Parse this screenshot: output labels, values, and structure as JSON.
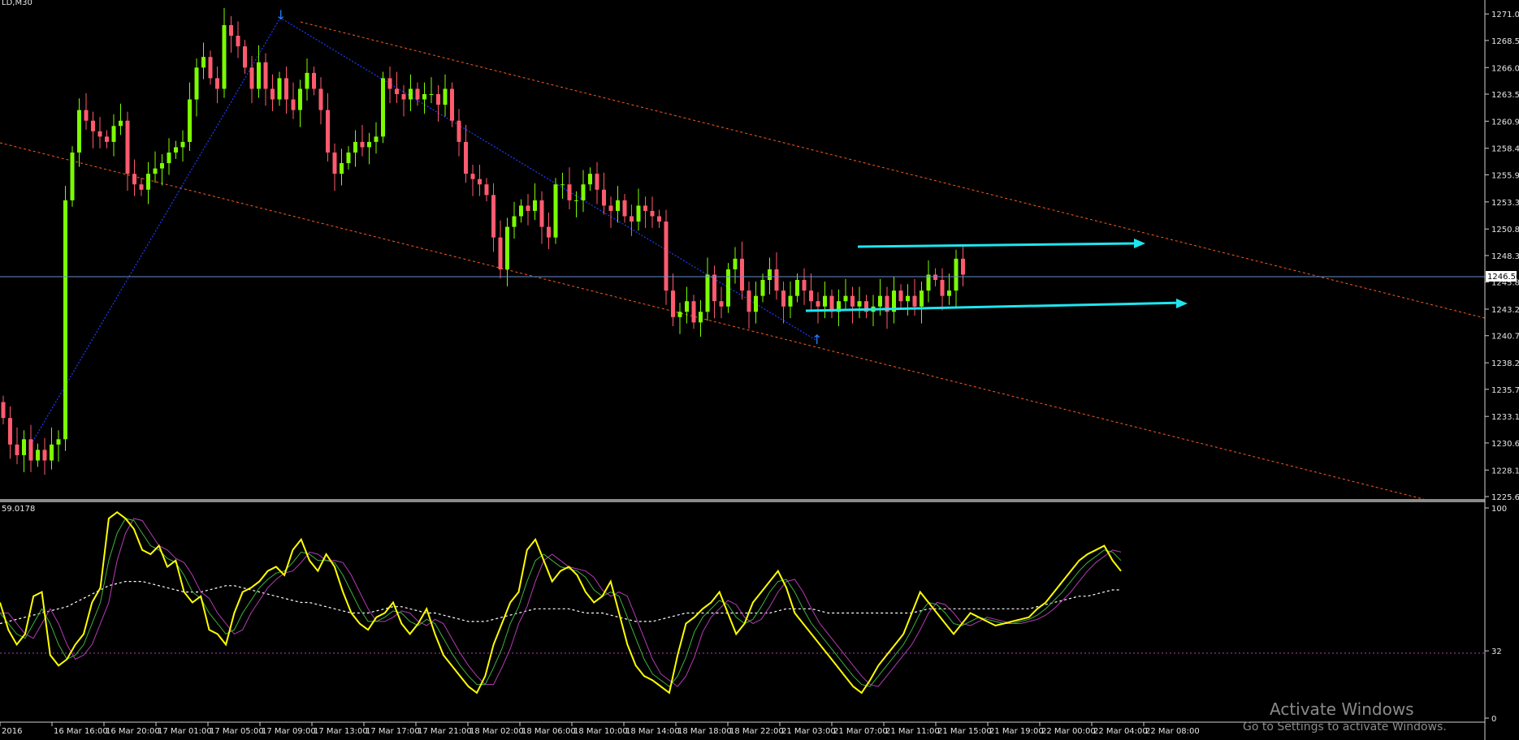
{
  "symbol_label": "LD,M30",
  "indicator_value": "59.0178",
  "price_axis": {
    "ticks": [
      "1271.05",
      "1268.55",
      "1266.00",
      "1263.50",
      "1260.95",
      "1258.40",
      "1255.90",
      "1253.35",
      "1250.80",
      "1248.30",
      "1245.80",
      "1243.25",
      "1240.75",
      "1238.20",
      "1235.70",
      "1233.15",
      "1230.65",
      "1228.10",
      "1225.60"
    ],
    "current_price": "1246.50"
  },
  "indicator_axis": {
    "ticks": [
      "100",
      "32",
      "0"
    ],
    "level": 32
  },
  "time_axis": [
    "2016",
    "16 Mar 16:00",
    "16 Mar 20:00",
    "17 Mar 01:00",
    "17 Mar 05:00",
    "17 Mar 09:00",
    "17 Mar 13:00",
    "17 Mar 17:00",
    "17 Mar 21:00",
    "18 Mar 02:00",
    "18 Mar 06:00",
    "18 Mar 10:00",
    "18 Mar 14:00",
    "18 Mar 18:00",
    "18 Mar 22:00",
    "21 Mar 03:00",
    "21 Mar 07:00",
    "21 Mar 11:00",
    "21 Mar 15:00",
    "21 Mar 19:00",
    "22 Mar 00:00",
    "22 Mar 04:00",
    "22 Mar 08:00"
  ],
  "watermark": {
    "title": "Activate Windows",
    "subtitle": "Go to Settings to activate Windows."
  },
  "colors": {
    "background": "#000000",
    "bull": "#7cfc00",
    "bear": "#ff5a6e",
    "channel": "#ff5a1a",
    "zigzag": "#1e3cff",
    "cyan": "#1ee6f0",
    "price_line": "#6a8cc8",
    "stoch_main": "#ffff00",
    "stoch_signal": "#3cb43c",
    "stoch_signal2": "#b43cb4",
    "stoch_ma": "#ffffff",
    "level_line": "#b43cb4"
  },
  "chart_data": {
    "type": "candlestick",
    "ylim": [
      1225.6,
      1271.6
    ],
    "candle_closes": [
      1233.0,
      1230.5,
      1229.5,
      1231.0,
      1229.0,
      1230.0,
      1229.0,
      1230.5,
      1231.0,
      1253.5,
      1258.0,
      1262.0,
      1261.0,
      1260.0,
      1259.5,
      1259.0,
      1260.5,
      1261.0,
      1256.0,
      1255.0,
      1254.5,
      1256.0,
      1256.5,
      1257.0,
      1258.0,
      1258.5,
      1259.0,
      1263.0,
      1266.0,
      1267.0,
      1265.0,
      1264.0,
      1270.0,
      1269.0,
      1268.0,
      1266.0,
      1264.0,
      1266.5,
      1264.0,
      1263.0,
      1265.0,
      1263.0,
      1262.0,
      1264.0,
      1265.5,
      1264.0,
      1262.0,
      1258.0,
      1256.0,
      1257.0,
      1258.0,
      1259.0,
      1258.5,
      1259.0,
      1259.5,
      1265.0,
      1264.0,
      1263.5,
      1263.0,
      1264.0,
      1263.0,
      1263.5,
      1263.5,
      1262.5,
      1264.0,
      1261.0,
      1259.0,
      1256.0,
      1255.5,
      1255.0,
      1254.0,
      1250.0,
      1247.0,
      1251.0,
      1252.0,
      1253.0,
      1252.5,
      1253.5,
      1251.0,
      1250.0,
      1255.0,
      1255.0,
      1253.5,
      1253.5,
      1255.0,
      1256.0,
      1254.5,
      1253.0,
      1252.5,
      1253.5,
      1252.0,
      1251.5,
      1253.0,
      1252.5,
      1252.0,
      1251.5,
      1245.0,
      1242.5,
      1243.0,
      1244.0,
      1242.0,
      1243.0,
      1246.5,
      1244.0,
      1243.5,
      1247.0,
      1248.0,
      1245.0,
      1243.0,
      1244.5,
      1246.0,
      1247.0,
      1245.0,
      1243.5,
      1244.5,
      1246.0,
      1245.0,
      1244.0,
      1243.5,
      1244.5,
      1243.0,
      1244.0,
      1244.5,
      1243.5,
      1244.0,
      1243.0,
      1243.5,
      1244.5,
      1243.0,
      1245.0,
      1244.0,
      1244.5,
      1243.5,
      1245.0,
      1246.5,
      1246.0,
      1244.5,
      1245.0,
      1248.0,
      1246.5
    ],
    "stochastic_k": [
      55,
      42,
      35,
      40,
      58,
      60,
      30,
      25,
      28,
      35,
      40,
      55,
      62,
      95,
      98,
      95,
      90,
      80,
      78,
      82,
      72,
      75,
      60,
      55,
      58,
      42,
      40,
      35,
      50,
      60,
      62,
      65,
      70,
      72,
      68,
      80,
      85,
      75,
      70,
      78,
      72,
      60,
      50,
      45,
      42,
      48,
      50,
      55,
      45,
      40,
      45,
      52,
      40,
      30,
      25,
      20,
      15,
      12,
      20,
      35,
      45,
      55,
      60,
      80,
      85,
      75,
      65,
      70,
      72,
      68,
      60,
      55,
      58,
      65,
      50,
      35,
      25,
      20,
      18,
      15,
      12,
      30,
      45,
      48,
      52,
      55,
      60,
      50,
      40,
      45,
      55,
      60,
      65,
      70,
      62,
      50,
      45,
      40,
      35,
      30,
      25,
      20,
      15,
      12,
      18,
      25,
      30,
      35,
      40,
      50,
      60,
      55,
      50,
      45,
      40,
      45,
      50,
      48,
      46,
      44,
      45,
      46,
      47,
      48,
      52,
      55,
      60,
      65,
      70,
      75,
      78,
      80,
      82,
      75,
      70
    ],
    "stochastic_d": [
      50,
      45,
      40,
      38,
      45,
      52,
      45,
      35,
      28,
      30,
      35,
      45,
      55,
      75,
      88,
      95,
      94,
      88,
      82,
      80,
      76,
      74,
      68,
      60,
      57,
      50,
      45,
      40,
      42,
      50,
      56,
      62,
      66,
      69,
      70,
      74,
      79,
      78,
      75,
      75,
      74,
      68,
      60,
      52,
      46,
      46,
      48,
      51,
      50,
      46,
      44,
      47,
      45,
      38,
      31,
      25,
      20,
      16,
      16,
      24,
      33,
      45,
      53,
      65,
      75,
      78,
      75,
      72,
      71,
      70,
      67,
      61,
      58,
      60,
      58,
      48,
      38,
      28,
      21,
      18,
      15,
      20,
      29,
      41,
      48,
      52,
      56,
      54,
      48,
      45,
      47,
      53,
      60,
      65,
      66,
      60,
      52,
      45,
      40,
      35,
      30,
      25,
      20,
      16,
      15,
      20,
      25,
      30,
      35,
      42,
      50,
      55,
      54,
      50,
      45,
      44,
      46,
      48,
      47,
      46,
      45,
      45,
      46,
      47,
      49,
      52,
      56,
      60,
      65,
      70,
      74,
      77,
      80,
      79,
      75
    ],
    "stochastic_ma": [
      45,
      46,
      47,
      48,
      49,
      50,
      51,
      52,
      53,
      55,
      57,
      59,
      61,
      63,
      64,
      65,
      65,
      65,
      64,
      63,
      62,
      61,
      60,
      60,
      60,
      61,
      62,
      63,
      63,
      62,
      61,
      60,
      59,
      58,
      57,
      56,
      55,
      55,
      54,
      53,
      52,
      51,
      50,
      50,
      50,
      51,
      52,
      53,
      53,
      52,
      51,
      50,
      50,
      49,
      48,
      47,
      46,
      46,
      46,
      47,
      48,
      49,
      50,
      51,
      52,
      52,
      52,
      52,
      52,
      51,
      50,
      50,
      50,
      49,
      48,
      47,
      46,
      46,
      46,
      47,
      48,
      49,
      50,
      50,
      50,
      50,
      50,
      50,
      50,
      50,
      50,
      50,
      50,
      51,
      52,
      52,
      52,
      52,
      51,
      50,
      50,
      50,
      50,
      50,
      50,
      50,
      50,
      50,
      50,
      50,
      51,
      52,
      52,
      52,
      52,
      52,
      52,
      52,
      52,
      52,
      52,
      52,
      52,
      52,
      53,
      54,
      55,
      56,
      57,
      58,
      58,
      59,
      60,
      61,
      61
    ]
  }
}
